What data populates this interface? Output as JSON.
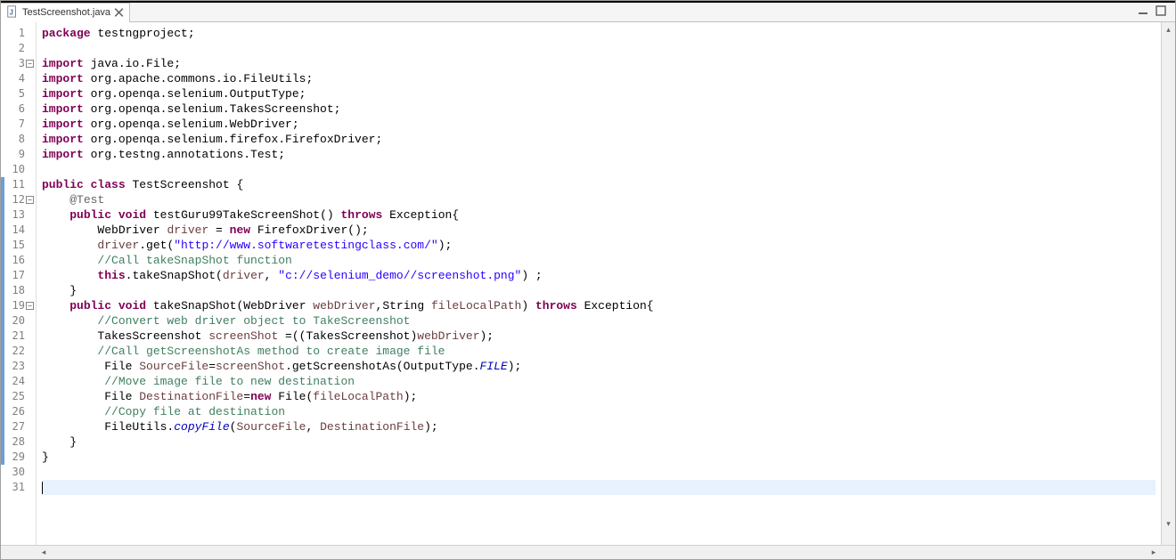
{
  "tab": {
    "label": "TestScreenshot.java",
    "icon": "java-file-icon"
  },
  "toolbar": {
    "minimize": "minimize-icon",
    "maximize": "maximize-icon"
  },
  "lineCount": 31,
  "currentLine": 31,
  "folds": [
    3,
    12,
    19
  ],
  "blueBars": [
    [
      11,
      18
    ],
    [
      19,
      28
    ],
    [
      29,
      29
    ]
  ],
  "code": [
    [
      [
        "kw",
        "package"
      ],
      [
        "",
        " testngproject;"
      ]
    ],
    [],
    [
      [
        "kw",
        "import"
      ],
      [
        "",
        " java.io.File;"
      ]
    ],
    [
      [
        "kw",
        "import"
      ],
      [
        "",
        " org.apache.commons.io.FileUtils;"
      ]
    ],
    [
      [
        "kw",
        "import"
      ],
      [
        "",
        " org.openqa.selenium.OutputType;"
      ]
    ],
    [
      [
        "kw",
        "import"
      ],
      [
        "",
        " org.openqa.selenium.TakesScreenshot;"
      ]
    ],
    [
      [
        "kw",
        "import"
      ],
      [
        "",
        " org.openqa.selenium.WebDriver;"
      ]
    ],
    [
      [
        "kw",
        "import"
      ],
      [
        "",
        " org.openqa.selenium.firefox.FirefoxDriver;"
      ]
    ],
    [
      [
        "kw",
        "import"
      ],
      [
        "",
        " org.testng.annotations.Test;"
      ]
    ],
    [],
    [
      [
        "kw",
        "public"
      ],
      [
        "",
        " "
      ],
      [
        "kw",
        "class"
      ],
      [
        "",
        " TestScreenshot {"
      ]
    ],
    [
      [
        "",
        "    "
      ],
      [
        "ann",
        "@Test"
      ]
    ],
    [
      [
        "",
        "    "
      ],
      [
        "kw",
        "public"
      ],
      [
        "",
        " "
      ],
      [
        "kw",
        "void"
      ],
      [
        "",
        " testGuru99TakeScreenShot() "
      ],
      [
        "kw",
        "throws"
      ],
      [
        "",
        " Exception{"
      ]
    ],
    [
      [
        "",
        "        WebDriver "
      ],
      [
        "var",
        "driver"
      ],
      [
        "",
        " = "
      ],
      [
        "kw",
        "new"
      ],
      [
        "",
        " FirefoxDriver();"
      ]
    ],
    [
      [
        "",
        "        "
      ],
      [
        "var",
        "driver"
      ],
      [
        "",
        ".get("
      ],
      [
        "str",
        "\"http://www.softwaretestingclass.com/\""
      ],
      [
        "",
        ");"
      ]
    ],
    [
      [
        "",
        "        "
      ],
      [
        "cmt",
        "//Call takeSnapShot function"
      ]
    ],
    [
      [
        "",
        "        "
      ],
      [
        "kw",
        "this"
      ],
      [
        "",
        ".takeSnapShot("
      ],
      [
        "var",
        "driver"
      ],
      [
        "",
        ", "
      ],
      [
        "str",
        "\"c://selenium_demo//screenshot.png\""
      ],
      [
        "",
        ") ;"
      ]
    ],
    [
      [
        "",
        "    }"
      ]
    ],
    [
      [
        "",
        "    "
      ],
      [
        "kw",
        "public"
      ],
      [
        "",
        " "
      ],
      [
        "kw",
        "void"
      ],
      [
        "",
        " takeSnapShot(WebDriver "
      ],
      [
        "var",
        "webDriver"
      ],
      [
        "",
        ",String "
      ],
      [
        "var",
        "fileLocalPath"
      ],
      [
        "",
        ") "
      ],
      [
        "kw",
        "throws"
      ],
      [
        "",
        " Exception{"
      ]
    ],
    [
      [
        "",
        "        "
      ],
      [
        "cmt",
        "//Convert web driver object to TakeScreenshot"
      ]
    ],
    [
      [
        "",
        "        TakesScreenshot "
      ],
      [
        "var",
        "screenShot"
      ],
      [
        "",
        " =((TakesScreenshot)"
      ],
      [
        "var",
        "webDriver"
      ],
      [
        "",
        ");"
      ]
    ],
    [
      [
        "",
        "        "
      ],
      [
        "cmt",
        "//Call getScreenshotAs method to create image file"
      ]
    ],
    [
      [
        "",
        "         File "
      ],
      [
        "var",
        "SourceFile"
      ],
      [
        "",
        "="
      ],
      [
        "var",
        "screenShot"
      ],
      [
        "",
        ".getScreenshotAs(OutputType."
      ],
      [
        "ital",
        "FILE"
      ],
      [
        "",
        ");"
      ]
    ],
    [
      [
        "",
        "         "
      ],
      [
        "cmt",
        "//Move image file to new destination"
      ]
    ],
    [
      [
        "",
        "         File "
      ],
      [
        "var",
        "DestinationFile"
      ],
      [
        "",
        "="
      ],
      [
        "kw",
        "new"
      ],
      [
        "",
        " File("
      ],
      [
        "var",
        "fileLocalPath"
      ],
      [
        "",
        ");"
      ]
    ],
    [
      [
        "",
        "         "
      ],
      [
        "cmt",
        "//Copy file at destination"
      ]
    ],
    [
      [
        "",
        "         FileUtils."
      ],
      [
        "ital",
        "copyFile"
      ],
      [
        "",
        "("
      ],
      [
        "var",
        "SourceFile"
      ],
      [
        "",
        ", "
      ],
      [
        "var",
        "DestinationFile"
      ],
      [
        "",
        ");"
      ]
    ],
    [
      [
        "",
        "    }"
      ]
    ],
    [
      [
        "",
        "}"
      ]
    ],
    [],
    []
  ]
}
